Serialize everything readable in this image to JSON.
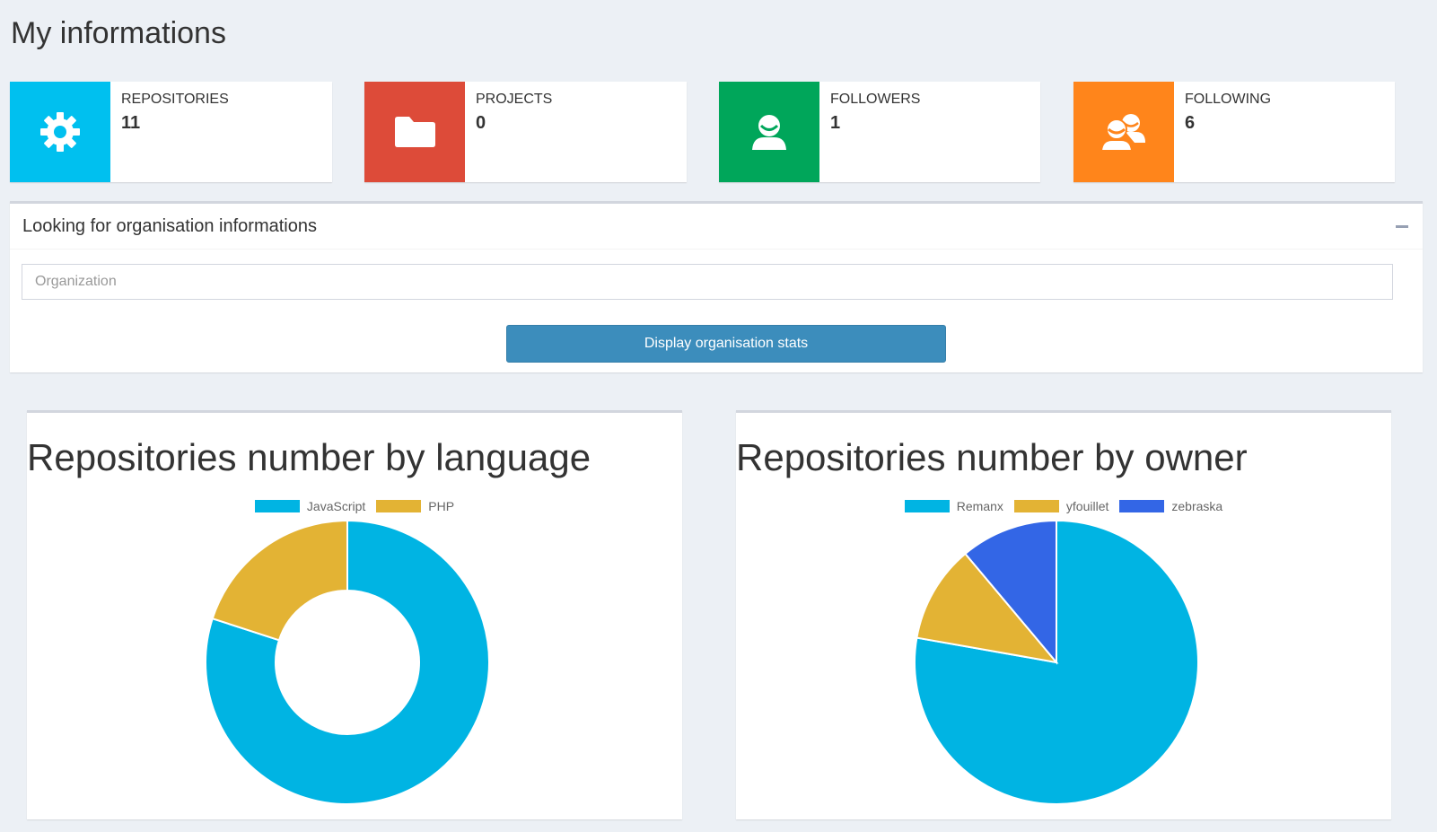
{
  "page": {
    "title": "My informations"
  },
  "info_boxes": [
    {
      "label": "REPOSITORIES",
      "value": "11",
      "icon": "gear-icon",
      "color": "#00c0ef"
    },
    {
      "label": "PROJECTS",
      "value": "0",
      "icon": "folder-icon",
      "color": "#dd4b39"
    },
    {
      "label": "FOLLOWERS",
      "value": "1",
      "icon": "user-icon",
      "color": "#00a65a"
    },
    {
      "label": "FOLLOWING",
      "value": "6",
      "icon": "users-icon",
      "color": "#ff851b"
    }
  ],
  "org_panel": {
    "title": "Looking for organisation informations",
    "input_placeholder": "Organization",
    "input_value": "",
    "button_label": "Display organisation stats"
  },
  "chart_data": [
    {
      "type": "doughnut",
      "title": "Repositories number by language",
      "legend_position": "top",
      "labels": [
        "JavaScript",
        "PHP"
      ],
      "values": [
        8,
        2
      ],
      "colors": [
        "#00b4e3",
        "#e3b334"
      ]
    },
    {
      "type": "pie",
      "title": "Repositories number by owner",
      "legend_position": "top",
      "labels": [
        "Remanx",
        "yfouillet",
        "zebraska"
      ],
      "values": [
        7,
        1,
        1
      ],
      "colors": [
        "#00b4e3",
        "#e3b334",
        "#3366e6"
      ]
    }
  ]
}
